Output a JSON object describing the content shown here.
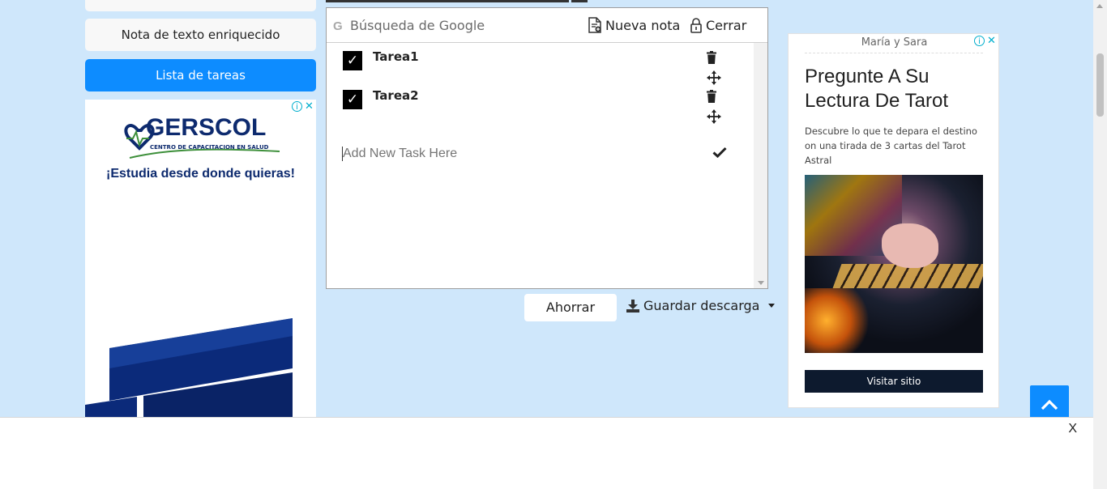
{
  "sidebar": {
    "rich_text_label": "Nota de texto enriquecido",
    "task_list_label": "Lista de tareas"
  },
  "left_ad": {
    "brand": "GERSCOL",
    "brand_sub": "CENTRO DE CAPACITACION EN SALUD",
    "tagline": "¡Estudia desde donde quieras!"
  },
  "toolbar": {
    "search_placeholder": "Búsqueda de Google",
    "new_note_label": "Nueva nota",
    "close_label": "Cerrar"
  },
  "tasks": [
    {
      "label": "Tarea1",
      "checked": true
    },
    {
      "label": "Tarea2",
      "checked": true
    }
  ],
  "new_task": {
    "placeholder": "Add New Task Here"
  },
  "actions": {
    "save_label": "Ahorrar",
    "download_label": "Guardar descarga"
  },
  "right_ad": {
    "sponsor": "María y Sara",
    "headline": "Pregunte A Su Lectura De Tarot",
    "description": "Descubre lo que te depara el destino on una tirada de 3 cartas del Tarot Astral",
    "cta": "Visitar sitio"
  },
  "banner": {
    "close_label": "X"
  },
  "colors": {
    "page_bg": "#cfe7fb",
    "accent": "#0d8cff",
    "brand_navy": "#0d2a6e"
  }
}
